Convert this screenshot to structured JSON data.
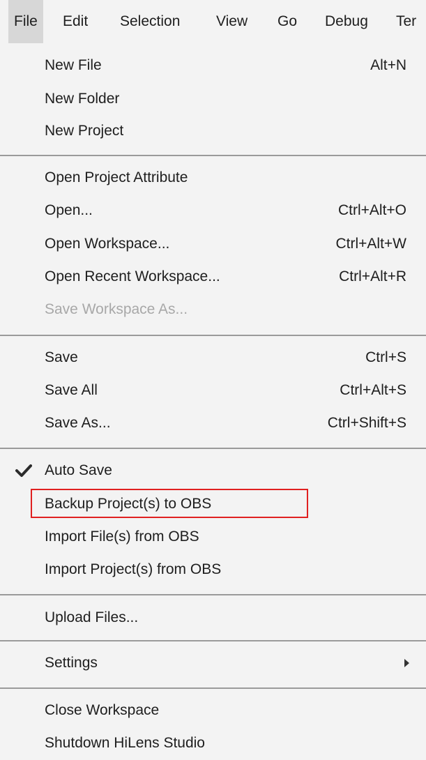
{
  "menubar": {
    "items": [
      {
        "label": "File",
        "active": true
      },
      {
        "label": "Edit"
      },
      {
        "label": "Selection"
      },
      {
        "label": "View"
      },
      {
        "label": "Go"
      },
      {
        "label": "Debug"
      },
      {
        "label": "Ter"
      }
    ]
  },
  "file_menu": {
    "new_file": {
      "label": "New File",
      "shortcut": "Alt+N"
    },
    "new_folder": {
      "label": "New Folder"
    },
    "new_project": {
      "label": "New Project"
    },
    "open_project_attribute": {
      "label": "Open Project Attribute"
    },
    "open": {
      "label": "Open...",
      "shortcut": "Ctrl+Alt+O"
    },
    "open_workspace": {
      "label": "Open Workspace...",
      "shortcut": "Ctrl+Alt+W"
    },
    "open_recent_workspace": {
      "label": "Open Recent Workspace...",
      "shortcut": "Ctrl+Alt+R"
    },
    "save_workspace_as": {
      "label": "Save Workspace As...",
      "disabled": true
    },
    "save": {
      "label": "Save",
      "shortcut": "Ctrl+S"
    },
    "save_all": {
      "label": "Save All",
      "shortcut": "Ctrl+Alt+S"
    },
    "save_as": {
      "label": "Save As...",
      "shortcut": "Ctrl+Shift+S"
    },
    "auto_save": {
      "label": "Auto Save",
      "checked": true
    },
    "backup_projects": {
      "label": "Backup Project(s) to OBS",
      "highlighted": true
    },
    "import_files": {
      "label": "Import File(s) from OBS"
    },
    "import_projects": {
      "label": "Import Project(s) from OBS"
    },
    "upload_files": {
      "label": "Upload Files..."
    },
    "settings": {
      "label": "Settings",
      "submenu": true
    },
    "close_workspace": {
      "label": "Close Workspace"
    },
    "shutdown": {
      "label": "Shutdown HiLens Studio"
    }
  },
  "icons": {
    "check": "check-icon",
    "submenu": "chevron-right-icon"
  },
  "colors": {
    "background": "#f3f3f3",
    "active_menubar": "#d7d7d7",
    "separator": "#9a9a9a",
    "disabled_text": "#a8a8a8",
    "highlight_border": "#e02020"
  }
}
